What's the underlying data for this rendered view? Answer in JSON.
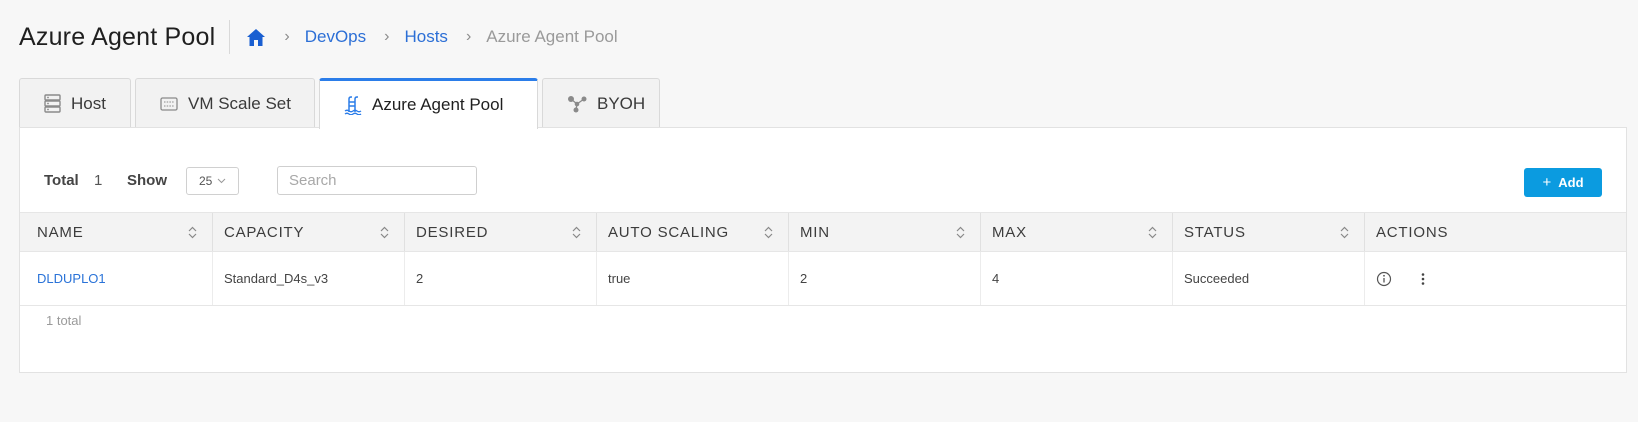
{
  "page": {
    "title": "Azure Agent Pool"
  },
  "breadcrumb": {
    "home_icon": "home-icon",
    "items": [
      "DevOps",
      "Hosts"
    ],
    "current": "Azure Agent Pool",
    "separator": "›"
  },
  "tabs": [
    {
      "label": "Host",
      "icon": "server-icon"
    },
    {
      "label": "VM Scale Set",
      "icon": "scale-set-icon"
    },
    {
      "label": "Azure Agent Pool",
      "icon": "pool-icon",
      "active": true
    },
    {
      "label": "BYOH",
      "icon": "nodes-icon"
    }
  ],
  "toolbar": {
    "total_label": "Total",
    "total_value": "1",
    "show_label": "Show",
    "show_value": "25",
    "search_placeholder": "Search",
    "add_label": "Add"
  },
  "table": {
    "columns": [
      "NAME",
      "CAPACITY",
      "DESIRED",
      "AUTO SCALING",
      "MIN",
      "MAX",
      "STATUS",
      "ACTIONS"
    ],
    "rows": [
      {
        "name": "DLDUPLO1",
        "capacity": "Standard_D4s_v3",
        "desired": "2",
        "auto_scaling": "true",
        "min": "2",
        "max": "4",
        "status": "Succeeded"
      }
    ],
    "footer": "1 total"
  },
  "colors": {
    "accent": "#0b9be0",
    "link": "#2c6fd6",
    "active_tab_border": "#2b7de9",
    "home_icon": "#1a5fd1"
  }
}
